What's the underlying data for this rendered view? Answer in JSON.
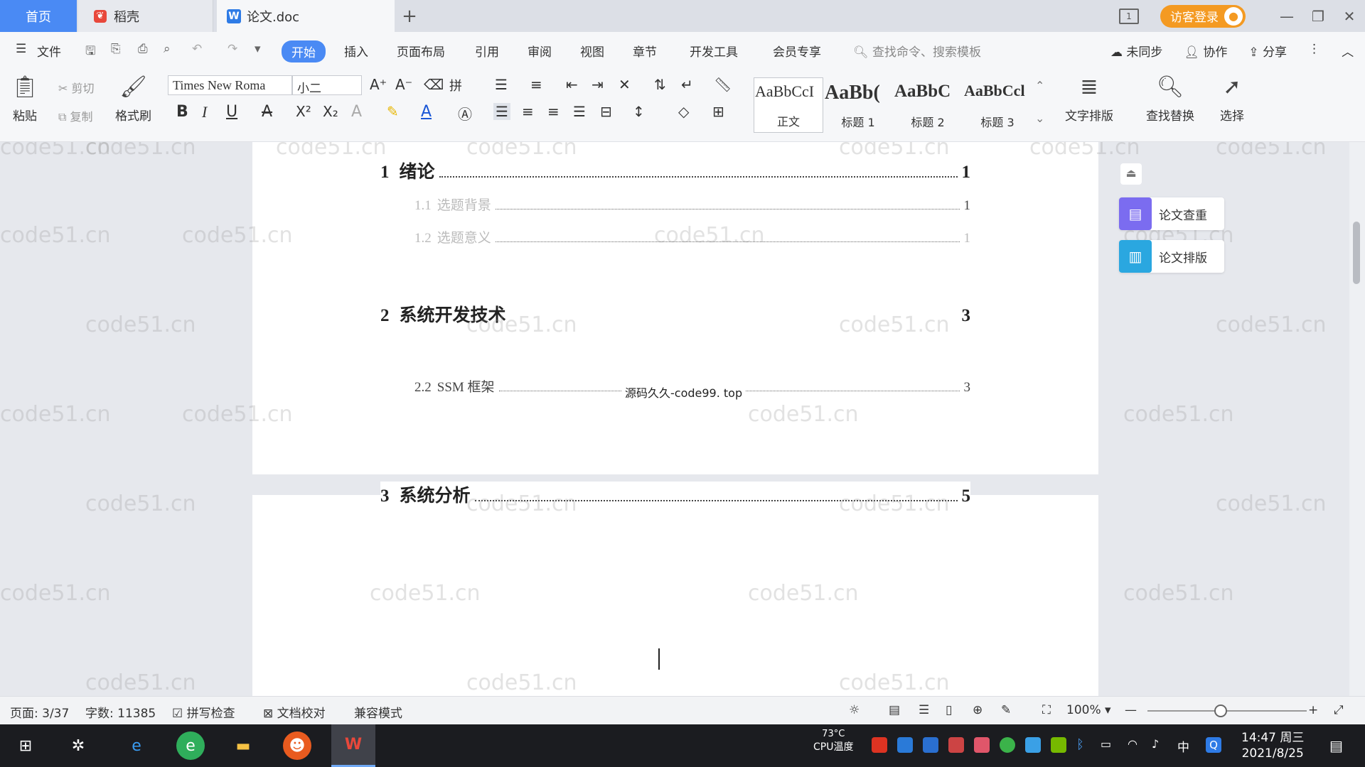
{
  "tabs": {
    "home": "首页",
    "docer": "稻壳",
    "doc": "论文.doc",
    "add": "+"
  },
  "topbar": {
    "window_label": "1",
    "login": "访客登录"
  },
  "menu": {
    "file": "文件",
    "items": [
      "开始",
      "插入",
      "页面布局",
      "引用",
      "审阅",
      "视图",
      "章节",
      "开发工具",
      "会员专享"
    ],
    "search": "查找命令、搜索模板",
    "sync": "未同步",
    "collab": "协作",
    "share": "分享"
  },
  "ribbon": {
    "paste": "粘贴",
    "cut": "剪切",
    "copy": "复制",
    "format_painter": "格式刷",
    "font": "Times New Roma",
    "size": "小二",
    "styles": [
      {
        "preview": "AaBbCcI",
        "label": "正文"
      },
      {
        "preview": "AaBb(",
        "label": "标题 1"
      },
      {
        "preview": "AaBbC",
        "label": "标题 2"
      },
      {
        "preview": "AaBbCcl",
        "label": "标题 3"
      }
    ],
    "text_layout": "文字排版",
    "find_replace": "查找替换",
    "select": "选择"
  },
  "document": {
    "toc": [
      {
        "num": "1",
        "title": "绪论",
        "page": "1",
        "level": 1
      },
      {
        "num": "1.1",
        "title": "选题背景",
        "page": "1",
        "level": 2
      },
      {
        "num": "1.2",
        "title": "选题意义",
        "page": "1",
        "level": 2
      },
      {
        "num": "2",
        "title": "系统开发技术",
        "page": "3",
        "level": 1
      },
      {
        "num": "2.2",
        "title": "SSM 框架",
        "page": "3",
        "level": 2
      },
      {
        "num": "3",
        "title": "系统分析",
        "page": "5",
        "level": 1
      }
    ],
    "overlay": "源码久久-code99. top",
    "watermark": "code51.cn"
  },
  "side": {
    "check": "论文查重",
    "layout": "论文排版"
  },
  "status": {
    "page": "页面: 3/37",
    "words": "字数: 11385",
    "spell": "拼写检查",
    "proof": "文档校对",
    "mode": "兼容模式",
    "zoom": "100%"
  },
  "taskbar": {
    "cpu_temp": "73°C",
    "cpu_label": "CPU温度",
    "ime": "中",
    "time": "14:47 周三",
    "date": "2021/8/25"
  }
}
